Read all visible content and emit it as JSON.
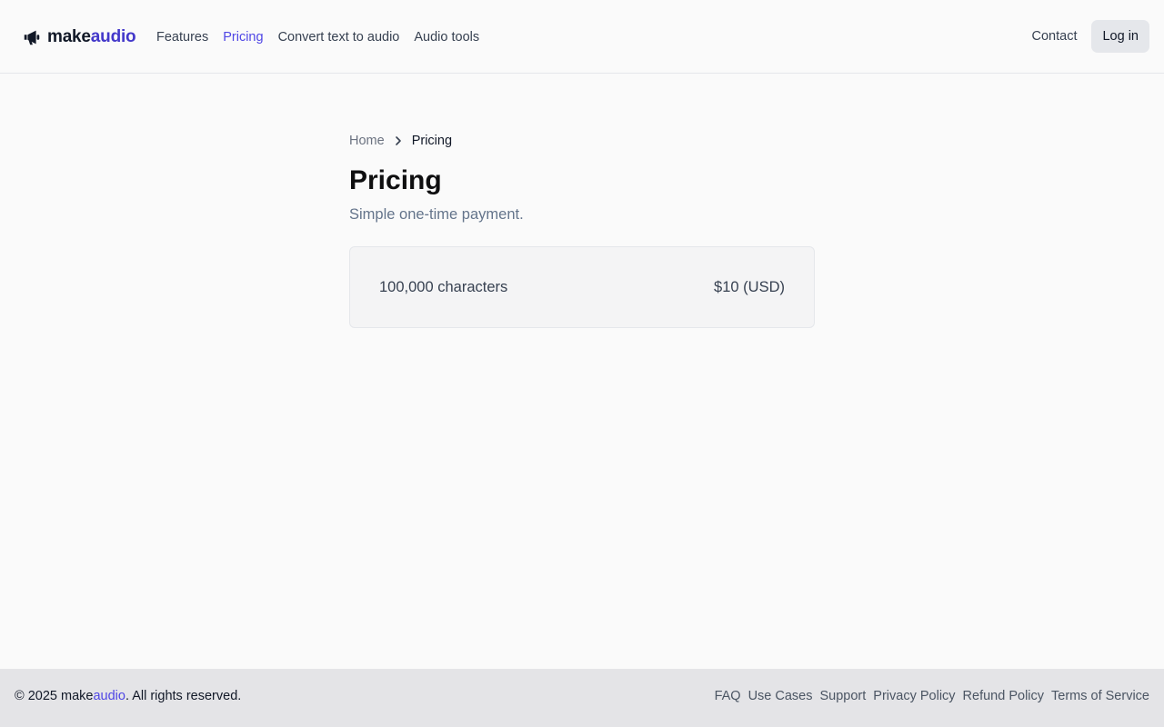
{
  "header": {
    "logo": {
      "icon": "megaphone-icon",
      "text_main": "make",
      "text_accent": "audio"
    },
    "nav": [
      {
        "label": "Features",
        "active": false
      },
      {
        "label": "Pricing",
        "active": true
      },
      {
        "label": "Convert text to audio",
        "active": false
      },
      {
        "label": "Audio tools",
        "active": false
      }
    ],
    "contact_label": "Contact",
    "login_label": "Log in"
  },
  "breadcrumb": {
    "home": "Home",
    "separator_icon": "chevron-right-icon",
    "current": "Pricing"
  },
  "main": {
    "title": "Pricing",
    "subtitle": "Simple one-time payment.",
    "plan": {
      "characters": "100,000 characters",
      "price": "$10 (USD)"
    }
  },
  "footer": {
    "copyright_prefix": "© 2025 ",
    "copyright_brand_main": "make",
    "copyright_brand_accent": "audio",
    "copyright_suffix": ". All rights reserved.",
    "links": [
      "FAQ",
      "Use Cases",
      "Support",
      "Privacy Policy",
      "Refund Policy",
      "Terms of Service"
    ]
  },
  "colors": {
    "accent": "#4f46e5",
    "background": "#fafafa",
    "footer_bg": "#e4e4e7"
  }
}
